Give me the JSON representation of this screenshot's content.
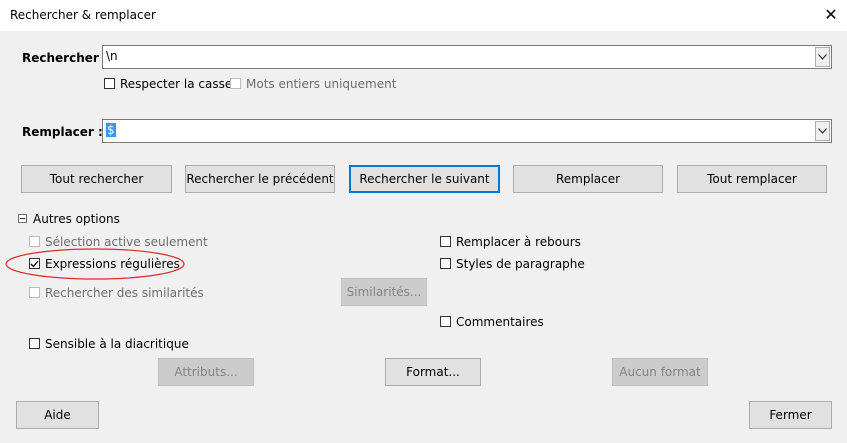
{
  "window": {
    "title": "Rechercher & remplacer",
    "close_label": "✕"
  },
  "search": {
    "label": "Rechercher :",
    "value": "\\n"
  },
  "options_row": {
    "match_case": "Respecter la casse",
    "whole_words": "Mots entiers uniquement"
  },
  "replace": {
    "label": "Remplacer :",
    "value": "$"
  },
  "buttons": {
    "find_all": "Tout rechercher",
    "find_prev": "Rechercher le précédent",
    "find_next": "Rechercher le suivant",
    "replace": "Remplacer",
    "replace_all": "Tout remplacer",
    "attributes": "Attributs...",
    "format": "Format...",
    "no_format": "Aucun format",
    "similarities": "Similarités...",
    "help": "Aide",
    "close": "Fermer"
  },
  "other_options": {
    "header": "Autres options",
    "active_selection": "Sélection active seulement",
    "regex": "Expressions régulières",
    "similarity": "Rechercher des similarités",
    "diacritic": "Sensible à la diacritique",
    "backwards": "Remplacer à rebours",
    "paragraph_styles": "Styles de paragraphe",
    "comments": "Commentaires"
  },
  "annotation_color": "#e0282e"
}
